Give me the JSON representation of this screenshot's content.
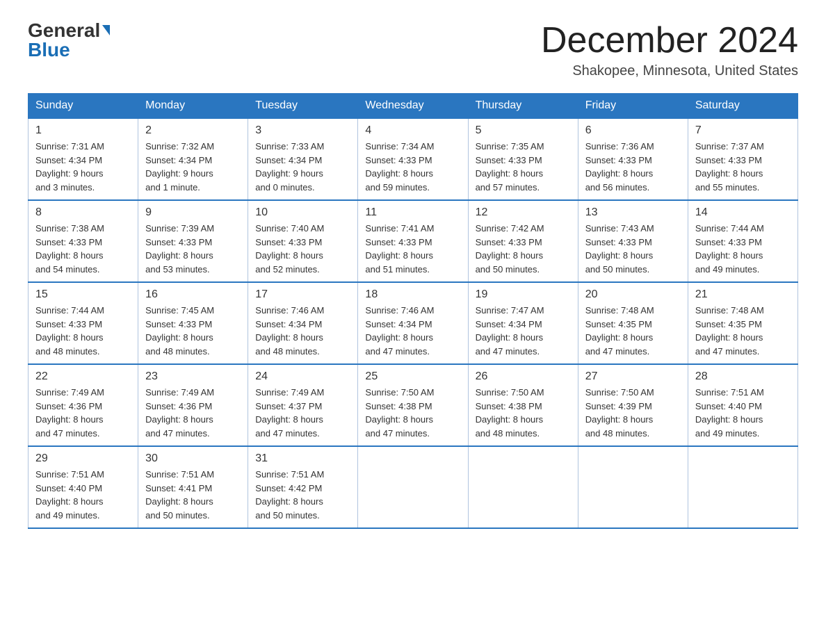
{
  "logo": {
    "general": "General",
    "blue": "Blue"
  },
  "header": {
    "month": "December 2024",
    "location": "Shakopee, Minnesota, United States"
  },
  "days_of_week": [
    "Sunday",
    "Monday",
    "Tuesday",
    "Wednesday",
    "Thursday",
    "Friday",
    "Saturday"
  ],
  "weeks": [
    [
      {
        "day": "1",
        "sunrise": "7:31 AM",
        "sunset": "4:34 PM",
        "daylight": "9 hours and 3 minutes."
      },
      {
        "day": "2",
        "sunrise": "7:32 AM",
        "sunset": "4:34 PM",
        "daylight": "9 hours and 1 minute."
      },
      {
        "day": "3",
        "sunrise": "7:33 AM",
        "sunset": "4:34 PM",
        "daylight": "9 hours and 0 minutes."
      },
      {
        "day": "4",
        "sunrise": "7:34 AM",
        "sunset": "4:33 PM",
        "daylight": "8 hours and 59 minutes."
      },
      {
        "day": "5",
        "sunrise": "7:35 AM",
        "sunset": "4:33 PM",
        "daylight": "8 hours and 57 minutes."
      },
      {
        "day": "6",
        "sunrise": "7:36 AM",
        "sunset": "4:33 PM",
        "daylight": "8 hours and 56 minutes."
      },
      {
        "day": "7",
        "sunrise": "7:37 AM",
        "sunset": "4:33 PM",
        "daylight": "8 hours and 55 minutes."
      }
    ],
    [
      {
        "day": "8",
        "sunrise": "7:38 AM",
        "sunset": "4:33 PM",
        "daylight": "8 hours and 54 minutes."
      },
      {
        "day": "9",
        "sunrise": "7:39 AM",
        "sunset": "4:33 PM",
        "daylight": "8 hours and 53 minutes."
      },
      {
        "day": "10",
        "sunrise": "7:40 AM",
        "sunset": "4:33 PM",
        "daylight": "8 hours and 52 minutes."
      },
      {
        "day": "11",
        "sunrise": "7:41 AM",
        "sunset": "4:33 PM",
        "daylight": "8 hours and 51 minutes."
      },
      {
        "day": "12",
        "sunrise": "7:42 AM",
        "sunset": "4:33 PM",
        "daylight": "8 hours and 50 minutes."
      },
      {
        "day": "13",
        "sunrise": "7:43 AM",
        "sunset": "4:33 PM",
        "daylight": "8 hours and 50 minutes."
      },
      {
        "day": "14",
        "sunrise": "7:44 AM",
        "sunset": "4:33 PM",
        "daylight": "8 hours and 49 minutes."
      }
    ],
    [
      {
        "day": "15",
        "sunrise": "7:44 AM",
        "sunset": "4:33 PM",
        "daylight": "8 hours and 48 minutes."
      },
      {
        "day": "16",
        "sunrise": "7:45 AM",
        "sunset": "4:33 PM",
        "daylight": "8 hours and 48 minutes."
      },
      {
        "day": "17",
        "sunrise": "7:46 AM",
        "sunset": "4:34 PM",
        "daylight": "8 hours and 48 minutes."
      },
      {
        "day": "18",
        "sunrise": "7:46 AM",
        "sunset": "4:34 PM",
        "daylight": "8 hours and 47 minutes."
      },
      {
        "day": "19",
        "sunrise": "7:47 AM",
        "sunset": "4:34 PM",
        "daylight": "8 hours and 47 minutes."
      },
      {
        "day": "20",
        "sunrise": "7:48 AM",
        "sunset": "4:35 PM",
        "daylight": "8 hours and 47 minutes."
      },
      {
        "day": "21",
        "sunrise": "7:48 AM",
        "sunset": "4:35 PM",
        "daylight": "8 hours and 47 minutes."
      }
    ],
    [
      {
        "day": "22",
        "sunrise": "7:49 AM",
        "sunset": "4:36 PM",
        "daylight": "8 hours and 47 minutes."
      },
      {
        "day": "23",
        "sunrise": "7:49 AM",
        "sunset": "4:36 PM",
        "daylight": "8 hours and 47 minutes."
      },
      {
        "day": "24",
        "sunrise": "7:49 AM",
        "sunset": "4:37 PM",
        "daylight": "8 hours and 47 minutes."
      },
      {
        "day": "25",
        "sunrise": "7:50 AM",
        "sunset": "4:38 PM",
        "daylight": "8 hours and 47 minutes."
      },
      {
        "day": "26",
        "sunrise": "7:50 AM",
        "sunset": "4:38 PM",
        "daylight": "8 hours and 48 minutes."
      },
      {
        "day": "27",
        "sunrise": "7:50 AM",
        "sunset": "4:39 PM",
        "daylight": "8 hours and 48 minutes."
      },
      {
        "day": "28",
        "sunrise": "7:51 AM",
        "sunset": "4:40 PM",
        "daylight": "8 hours and 49 minutes."
      }
    ],
    [
      {
        "day": "29",
        "sunrise": "7:51 AM",
        "sunset": "4:40 PM",
        "daylight": "8 hours and 49 minutes."
      },
      {
        "day": "30",
        "sunrise": "7:51 AM",
        "sunset": "4:41 PM",
        "daylight": "8 hours and 50 minutes."
      },
      {
        "day": "31",
        "sunrise": "7:51 AM",
        "sunset": "4:42 PM",
        "daylight": "8 hours and 50 minutes."
      },
      null,
      null,
      null,
      null
    ]
  ]
}
